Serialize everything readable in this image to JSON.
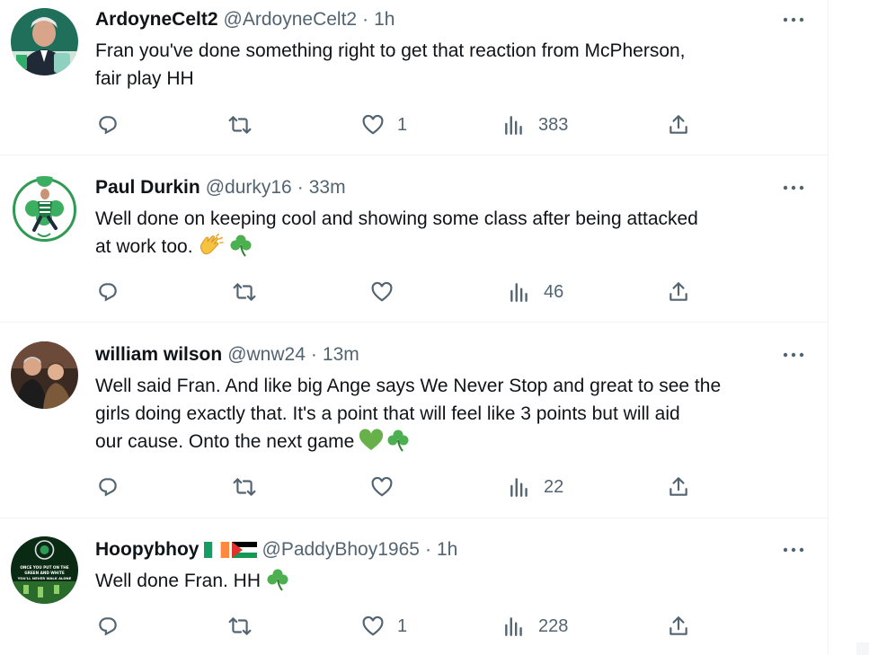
{
  "tweets": [
    {
      "name": "ArdoyneCelt2",
      "handle": "@ArdoyneCelt2",
      "sep": "·",
      "time": "1h",
      "flags": [],
      "text_line1": "Fran you've done something right to get that reaction from McPherson,",
      "text_line2": "fair play HH",
      "emojis": [],
      "replies": "",
      "retweets": "",
      "likes": "1",
      "views": "383"
    },
    {
      "name": "Paul Durkin",
      "handle": "@durky16",
      "sep": "·",
      "time": "33m",
      "flags": [],
      "text_line1": "Well done on keeping cool and showing some class after being attacked",
      "text_line2": "at work too.",
      "emojis": [
        "clapping-hands",
        "shamrock"
      ],
      "replies": "",
      "retweets": "",
      "likes": "",
      "views": "46"
    },
    {
      "name": "william wilson",
      "handle": "@wnw24",
      "sep": "·",
      "time": "13m",
      "flags": [],
      "text_line1": "Well said Fran. And like big Ange says We Never Stop and great to see the",
      "text_line2": "girls doing exactly that. It's a point that will feel like 3 points but will aid",
      "text_line3": "our cause. Onto the next game",
      "emojis": [
        "green-heart",
        "shamrock"
      ],
      "replies": "",
      "retweets": "",
      "likes": "",
      "views": "22"
    },
    {
      "name": "Hoopybhoy",
      "handle": "@PaddyBhoy1965",
      "sep": "·",
      "time": "1h",
      "flags": [
        "ireland-flag",
        "palestine-flag"
      ],
      "text_line1": "Well done Fran. HH",
      "emojis": [
        "shamrock"
      ],
      "replies": "",
      "retweets": "",
      "likes": "1",
      "views": "228"
    }
  ],
  "avatar4_text": {
    "line1": "ONCE YOU PUT ON THE",
    "line2": "GREEN AND WHITE",
    "line3": "YOU'LL NEVER WALK ALONE"
  },
  "colors": {
    "text": "#0f1419",
    "secondary": "#536471",
    "divider": "#eff3f4",
    "celtic_green": "#1b8a3a"
  },
  "icons": [
    "reply-icon",
    "retweet-icon",
    "like-icon",
    "views-icon",
    "share-icon",
    "more-icon"
  ]
}
